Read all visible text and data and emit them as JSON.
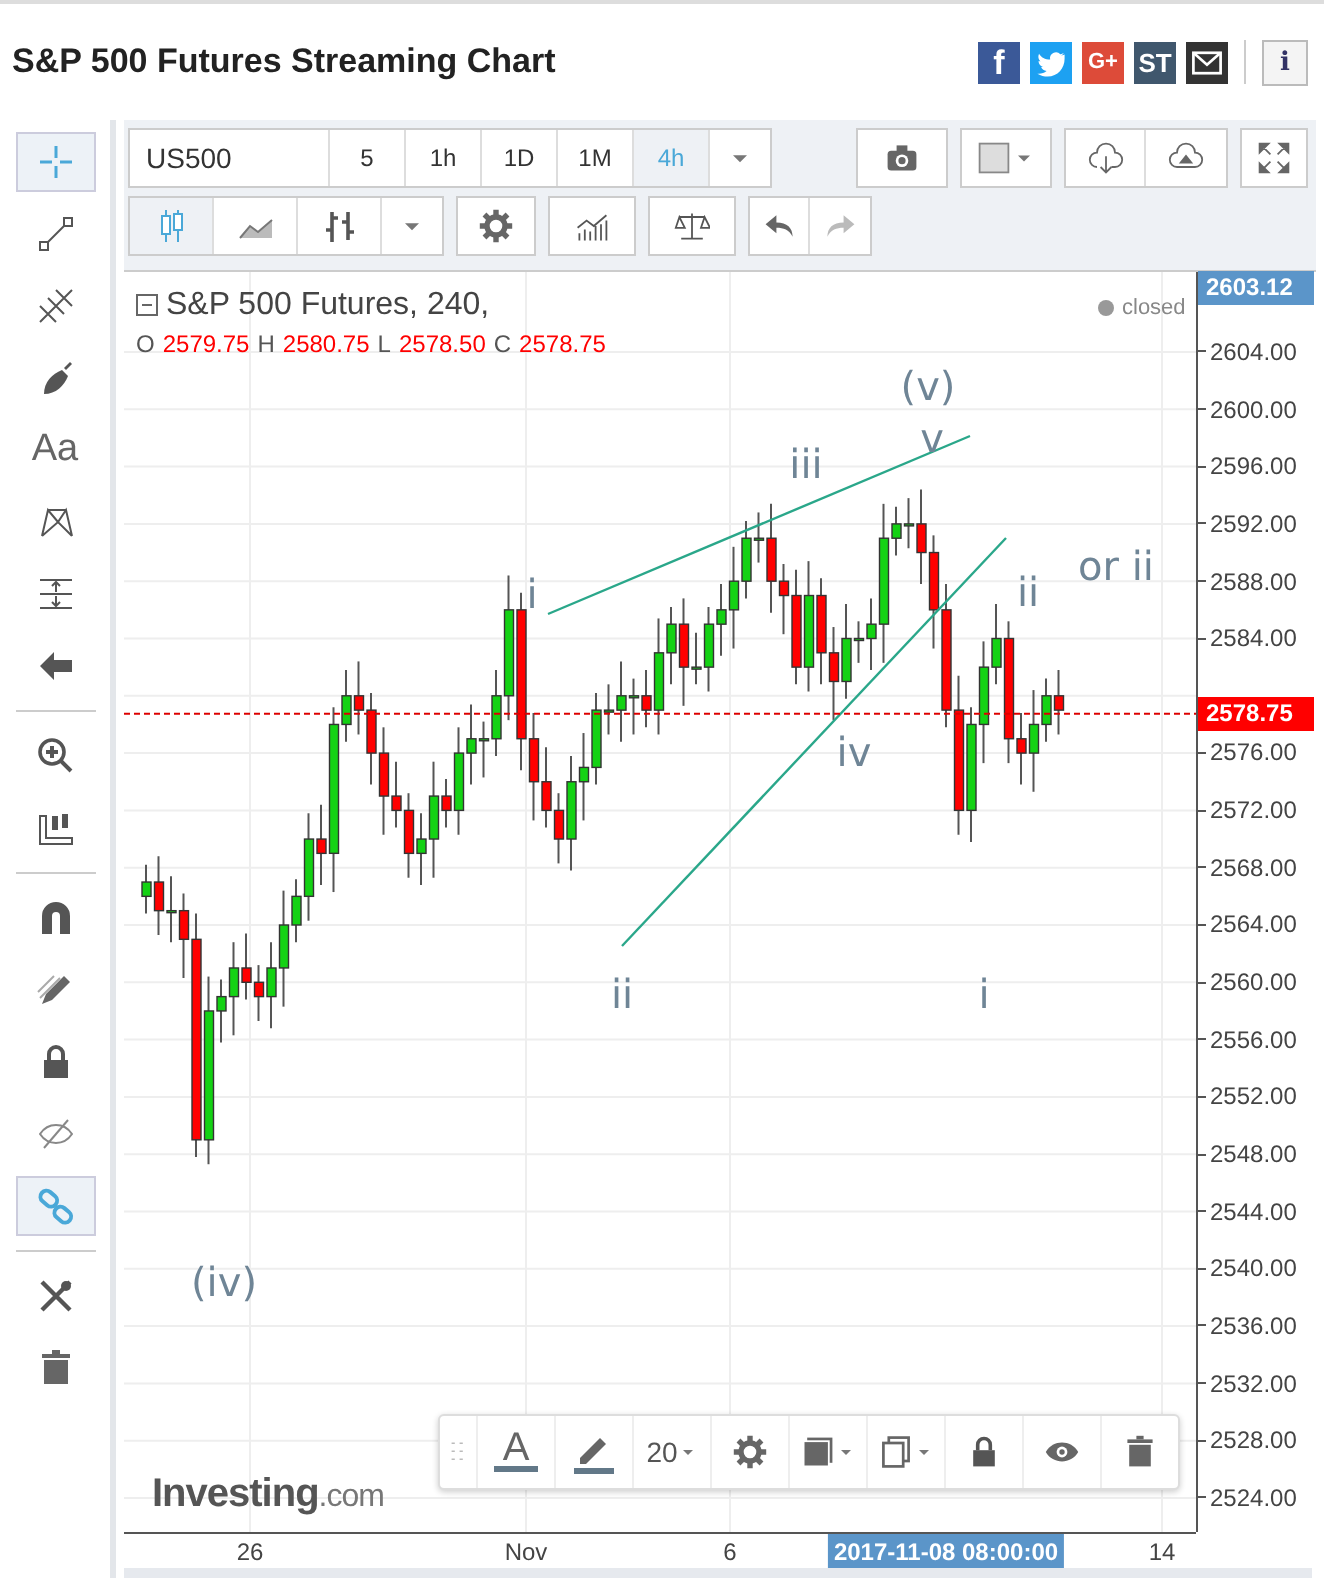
{
  "header": {
    "title": "S&P 500 Futures Streaming Chart",
    "share": [
      {
        "kind": "facebook",
        "label": "f",
        "color": "#3b5998"
      },
      {
        "kind": "twitter",
        "color": "#1da1f2"
      },
      {
        "kind": "googleplus",
        "label": "G+",
        "color": "#dd4b39"
      },
      {
        "kind": "stocktwits",
        "label": "ST",
        "color": "#40576d"
      },
      {
        "kind": "email",
        "color": "#333333"
      }
    ],
    "info": "i"
  },
  "drawing_tools": [
    [
      {
        "kind": "crosshair",
        "selected": true
      },
      {
        "kind": "line",
        "selected": false
      },
      {
        "kind": "fork",
        "selected": false
      },
      {
        "kind": "brush",
        "selected": false
      },
      {
        "kind": "text",
        "label": "Aa",
        "selected": false
      },
      {
        "kind": "pattern",
        "selected": false
      },
      {
        "kind": "measure",
        "selected": false
      },
      {
        "kind": "arrow",
        "selected": false
      }
    ],
    [
      {
        "kind": "zoom",
        "selected": false
      },
      {
        "kind": "ruler",
        "selected": false
      }
    ],
    [
      {
        "kind": "magnet",
        "selected": false
      },
      {
        "kind": "pencils",
        "selected": false
      },
      {
        "kind": "lock",
        "selected": false
      },
      {
        "kind": "hide",
        "selected": false
      },
      {
        "kind": "link",
        "selected": true
      }
    ],
    [
      {
        "kind": "tools",
        "selected": false
      },
      {
        "kind": "trash",
        "selected": false
      }
    ]
  ],
  "toolbar": {
    "symbol": "US500",
    "intervals": [
      {
        "label": "5",
        "selected": false
      },
      {
        "label": "1h",
        "selected": false
      },
      {
        "label": "1D",
        "selected": false
      },
      {
        "label": "1M",
        "selected": false
      },
      {
        "label": "4h",
        "selected": true
      }
    ],
    "chart_styles": [
      {
        "kind": "candles",
        "selected": true
      },
      {
        "kind": "area",
        "selected": false
      },
      {
        "kind": "bars",
        "selected": false
      }
    ]
  },
  "chart": {
    "legend": {
      "title": "S&P 500 Futures, 240,",
      "ohlc": [
        {
          "key": "O",
          "value": "2579.75"
        },
        {
          "key": "H",
          "value": "2580.75"
        },
        {
          "key": "L",
          "value": "2578.50"
        },
        {
          "key": "C",
          "value": "2578.75"
        }
      ]
    },
    "status": "closed",
    "price_axis": [
      "2604.00",
      "2600.00",
      "2596.00",
      "2592.00",
      "2588.00",
      "2584.00",
      "2576.00",
      "2572.00",
      "2568.00",
      "2564.00",
      "2560.00",
      "2556.00",
      "2552.00",
      "2548.00",
      "2544.00",
      "2540.00",
      "2536.00",
      "2532.00",
      "2528.00",
      "2524.00"
    ],
    "price_badges": [
      {
        "kind": "high",
        "label": "2603.12"
      },
      {
        "kind": "last",
        "label": "2578.75"
      }
    ],
    "time_axis": [
      {
        "label": "26",
        "selected": false
      },
      {
        "label": "Nov",
        "selected": false
      },
      {
        "label": "6",
        "selected": false
      },
      {
        "label": "2017-11-08 08:00:00",
        "selected": true
      },
      {
        "label": "14",
        "selected": false
      }
    ],
    "wave_labels": [
      "(iv)",
      "i",
      "ii",
      "iii",
      "iv",
      "(v)",
      "v",
      "i",
      "ii",
      "or ii"
    ],
    "drawing_toolbar": {
      "text_glyph": "A",
      "font_size": "20"
    },
    "logo": {
      "brand": "Investing",
      "domain": ".com"
    }
  }
}
